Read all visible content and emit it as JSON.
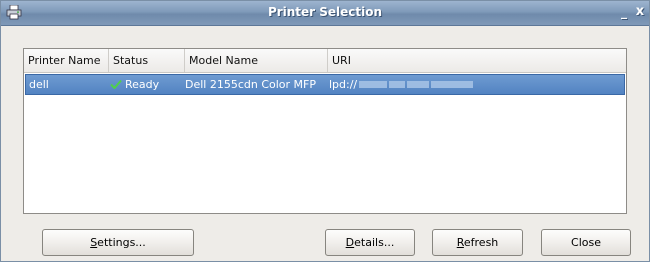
{
  "window": {
    "title": "Printer Selection",
    "minimize_label": "_",
    "close_label": "x"
  },
  "table": {
    "columns": [
      "Printer Name",
      "Status",
      "Model Name",
      "URI"
    ],
    "rows": [
      {
        "printer_name": "dell",
        "status": "Ready",
        "model_name": "Dell 2155cdn Color MFP",
        "uri": "lpd://",
        "selected": true
      }
    ]
  },
  "buttons": {
    "settings": {
      "mnemonic": "S",
      "rest": "ettings..."
    },
    "details": {
      "mnemonic": "D",
      "rest": "etails..."
    },
    "refresh": {
      "mnemonic": "R",
      "rest": "efresh"
    },
    "close": {
      "label": "Close"
    }
  },
  "colors": {
    "titlebar": "#7f9ab9",
    "selection": "#5f8fcb",
    "window_bg": "#eeece8"
  },
  "icons": {
    "title_app": "printer-icon",
    "status_ready": "check-icon"
  }
}
